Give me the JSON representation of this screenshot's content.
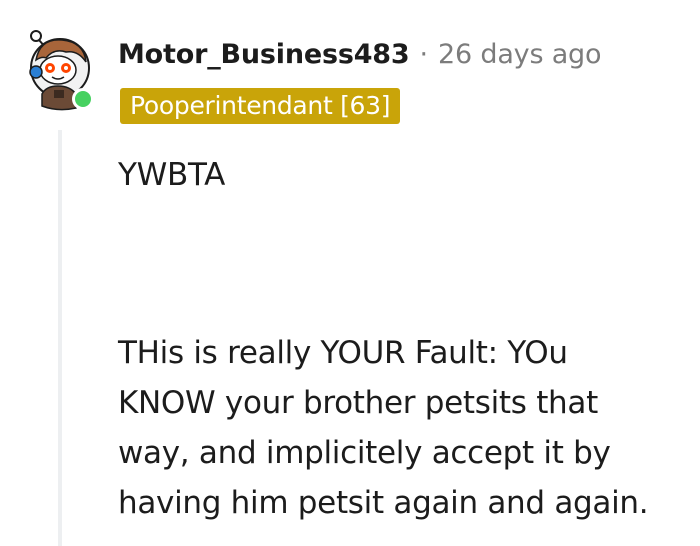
{
  "comment": {
    "username": "Motor_Business483",
    "separator": "·",
    "timestamp": "26 days ago",
    "flair": "Pooperintendant [63]",
    "online": true,
    "body": {
      "paragraph1": "YWBTA",
      "paragraph2_lines": [
        "THis is really YOUR Fault: YOu",
        "KNOW your brother petsits that",
        "way, and implicitely accept it by",
        "having him petsit again and again."
      ]
    }
  },
  "colors": {
    "flair_bg": "#c9a409",
    "online_dot": "#46d160",
    "meta_gray": "#7c7c7c",
    "thread_line": "#edeff1"
  },
  "icons": {
    "avatar": "snoo-avatar-icon",
    "online": "online-status-icon"
  }
}
